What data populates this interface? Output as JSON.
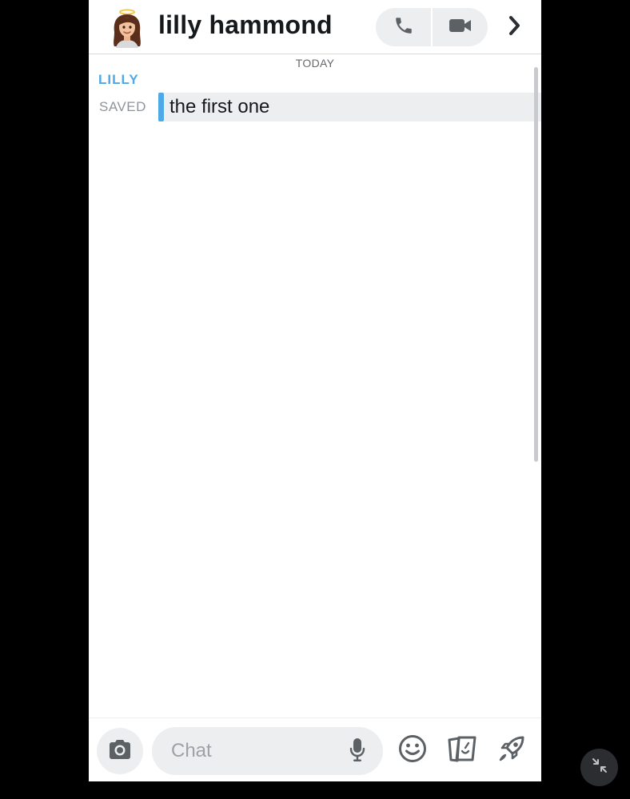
{
  "header": {
    "contact_name": "lilly hammond",
    "voice_call_icon": "phone-icon",
    "video_call_icon": "video-camera-icon",
    "more_icon": "chevron-right-icon"
  },
  "conversation": {
    "date_separator": "TODAY",
    "sender_name": "LILLY",
    "messages": [
      {
        "status": "SAVED",
        "text": "the first one"
      }
    ]
  },
  "composer": {
    "placeholder": "Chat",
    "value": "",
    "camera_icon": "camera-icon",
    "mic_icon": "microphone-icon",
    "emoji_icon": "smiley-icon",
    "sticker_icon": "sticker-cards-icon",
    "games_icon": "rocket-icon"
  },
  "overlay": {
    "minimize_icon": "collapse-arrows-icon"
  },
  "colors": {
    "accent_blue": "#4ea9e6",
    "bubble_bg": "#eceef0",
    "text_dark": "#16191c",
    "muted": "#8f959b"
  }
}
